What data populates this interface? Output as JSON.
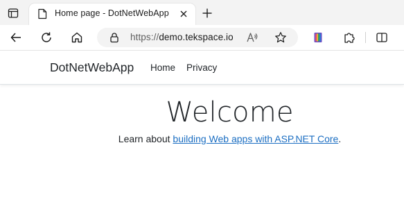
{
  "browser": {
    "tab": {
      "title": "Home page - DotNetWebApp"
    },
    "address_bar": {
      "scheme": "https://",
      "host": "demo.tekspace.io"
    },
    "icons": {
      "tab_actions": "tab-actions-icon",
      "favicon": "page-icon",
      "close_tab": "close-icon",
      "new_tab": "plus-icon",
      "back": "back-arrow-icon",
      "refresh": "refresh-icon",
      "home": "home-icon",
      "site_info": "lock-icon",
      "read_aloud": "read-aloud-icon",
      "favorite": "star-icon",
      "extension": "extension-icon",
      "extensions": "puzzle-icon",
      "split_screen": "split-screen-icon"
    }
  },
  "site": {
    "brand": "DotNetWebApp",
    "nav": [
      {
        "label": "Home"
      },
      {
        "label": "Privacy"
      }
    ]
  },
  "main": {
    "heading": "Welcome",
    "learn_prefix": "Learn about ",
    "learn_link": "building Web apps with ASP.NET Core",
    "learn_suffix": "."
  },
  "colors": {
    "link": "#1b6ec2",
    "text": "#212529",
    "chrome_bg": "#f3f3f3"
  }
}
